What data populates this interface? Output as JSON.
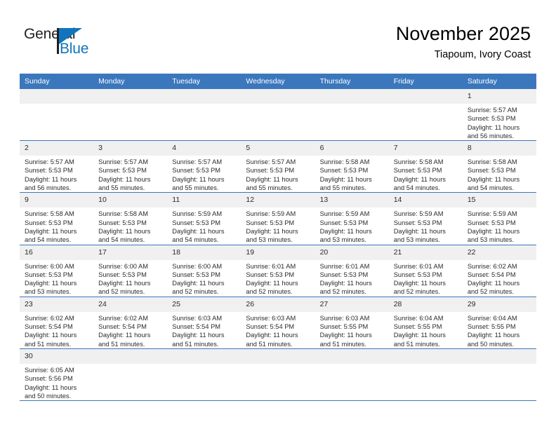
{
  "brand": {
    "name_top": "General",
    "name_bottom": "Blue",
    "triangle_icon": "triangle-icon",
    "accent_color": "#1175be"
  },
  "header": {
    "title": "November 2025",
    "subtitle": "Tiapoum, Ivory Coast"
  },
  "theme": {
    "header_blue": "#3b77bd",
    "daynum_gray": "#f0f0f0"
  },
  "calendar": {
    "weekday_headers": [
      "Sunday",
      "Monday",
      "Tuesday",
      "Wednesday",
      "Thursday",
      "Friday",
      "Saturday"
    ],
    "weeks": [
      [
        {
          "day": "",
          "blank": true
        },
        {
          "day": "",
          "blank": true
        },
        {
          "day": "",
          "blank": true
        },
        {
          "day": "",
          "blank": true
        },
        {
          "day": "",
          "blank": true
        },
        {
          "day": "",
          "blank": true
        },
        {
          "day": "1",
          "sunrise": "Sunrise: 5:57 AM",
          "sunset": "Sunset: 5:53 PM",
          "daylight": "Daylight: 11 hours and 56 minutes."
        }
      ],
      [
        {
          "day": "2",
          "sunrise": "Sunrise: 5:57 AM",
          "sunset": "Sunset: 5:53 PM",
          "daylight": "Daylight: 11 hours and 56 minutes."
        },
        {
          "day": "3",
          "sunrise": "Sunrise: 5:57 AM",
          "sunset": "Sunset: 5:53 PM",
          "daylight": "Daylight: 11 hours and 55 minutes."
        },
        {
          "day": "4",
          "sunrise": "Sunrise: 5:57 AM",
          "sunset": "Sunset: 5:53 PM",
          "daylight": "Daylight: 11 hours and 55 minutes."
        },
        {
          "day": "5",
          "sunrise": "Sunrise: 5:57 AM",
          "sunset": "Sunset: 5:53 PM",
          "daylight": "Daylight: 11 hours and 55 minutes."
        },
        {
          "day": "6",
          "sunrise": "Sunrise: 5:58 AM",
          "sunset": "Sunset: 5:53 PM",
          "daylight": "Daylight: 11 hours and 55 minutes."
        },
        {
          "day": "7",
          "sunrise": "Sunrise: 5:58 AM",
          "sunset": "Sunset: 5:53 PM",
          "daylight": "Daylight: 11 hours and 54 minutes."
        },
        {
          "day": "8",
          "sunrise": "Sunrise: 5:58 AM",
          "sunset": "Sunset: 5:53 PM",
          "daylight": "Daylight: 11 hours and 54 minutes."
        }
      ],
      [
        {
          "day": "9",
          "sunrise": "Sunrise: 5:58 AM",
          "sunset": "Sunset: 5:53 PM",
          "daylight": "Daylight: 11 hours and 54 minutes."
        },
        {
          "day": "10",
          "sunrise": "Sunrise: 5:58 AM",
          "sunset": "Sunset: 5:53 PM",
          "daylight": "Daylight: 11 hours and 54 minutes."
        },
        {
          "day": "11",
          "sunrise": "Sunrise: 5:59 AM",
          "sunset": "Sunset: 5:53 PM",
          "daylight": "Daylight: 11 hours and 54 minutes."
        },
        {
          "day": "12",
          "sunrise": "Sunrise: 5:59 AM",
          "sunset": "Sunset: 5:53 PM",
          "daylight": "Daylight: 11 hours and 53 minutes."
        },
        {
          "day": "13",
          "sunrise": "Sunrise: 5:59 AM",
          "sunset": "Sunset: 5:53 PM",
          "daylight": "Daylight: 11 hours and 53 minutes."
        },
        {
          "day": "14",
          "sunrise": "Sunrise: 5:59 AM",
          "sunset": "Sunset: 5:53 PM",
          "daylight": "Daylight: 11 hours and 53 minutes."
        },
        {
          "day": "15",
          "sunrise": "Sunrise: 5:59 AM",
          "sunset": "Sunset: 5:53 PM",
          "daylight": "Daylight: 11 hours and 53 minutes."
        }
      ],
      [
        {
          "day": "16",
          "sunrise": "Sunrise: 6:00 AM",
          "sunset": "Sunset: 5:53 PM",
          "daylight": "Daylight: 11 hours and 53 minutes."
        },
        {
          "day": "17",
          "sunrise": "Sunrise: 6:00 AM",
          "sunset": "Sunset: 5:53 PM",
          "daylight": "Daylight: 11 hours and 52 minutes."
        },
        {
          "day": "18",
          "sunrise": "Sunrise: 6:00 AM",
          "sunset": "Sunset: 5:53 PM",
          "daylight": "Daylight: 11 hours and 52 minutes."
        },
        {
          "day": "19",
          "sunrise": "Sunrise: 6:01 AM",
          "sunset": "Sunset: 5:53 PM",
          "daylight": "Daylight: 11 hours and 52 minutes."
        },
        {
          "day": "20",
          "sunrise": "Sunrise: 6:01 AM",
          "sunset": "Sunset: 5:53 PM",
          "daylight": "Daylight: 11 hours and 52 minutes."
        },
        {
          "day": "21",
          "sunrise": "Sunrise: 6:01 AM",
          "sunset": "Sunset: 5:53 PM",
          "daylight": "Daylight: 11 hours and 52 minutes."
        },
        {
          "day": "22",
          "sunrise": "Sunrise: 6:02 AM",
          "sunset": "Sunset: 5:54 PM",
          "daylight": "Daylight: 11 hours and 52 minutes."
        }
      ],
      [
        {
          "day": "23",
          "sunrise": "Sunrise: 6:02 AM",
          "sunset": "Sunset: 5:54 PM",
          "daylight": "Daylight: 11 hours and 51 minutes."
        },
        {
          "day": "24",
          "sunrise": "Sunrise: 6:02 AM",
          "sunset": "Sunset: 5:54 PM",
          "daylight": "Daylight: 11 hours and 51 minutes."
        },
        {
          "day": "25",
          "sunrise": "Sunrise: 6:03 AM",
          "sunset": "Sunset: 5:54 PM",
          "daylight": "Daylight: 11 hours and 51 minutes."
        },
        {
          "day": "26",
          "sunrise": "Sunrise: 6:03 AM",
          "sunset": "Sunset: 5:54 PM",
          "daylight": "Daylight: 11 hours and 51 minutes."
        },
        {
          "day": "27",
          "sunrise": "Sunrise: 6:03 AM",
          "sunset": "Sunset: 5:55 PM",
          "daylight": "Daylight: 11 hours and 51 minutes."
        },
        {
          "day": "28",
          "sunrise": "Sunrise: 6:04 AM",
          "sunset": "Sunset: 5:55 PM",
          "daylight": "Daylight: 11 hours and 51 minutes."
        },
        {
          "day": "29",
          "sunrise": "Sunrise: 6:04 AM",
          "sunset": "Sunset: 5:55 PM",
          "daylight": "Daylight: 11 hours and 50 minutes."
        }
      ],
      [
        {
          "day": "30",
          "sunrise": "Sunrise: 6:05 AM",
          "sunset": "Sunset: 5:56 PM",
          "daylight": "Daylight: 11 hours and 50 minutes."
        },
        {
          "day": "",
          "blank": true
        },
        {
          "day": "",
          "blank": true
        },
        {
          "day": "",
          "blank": true
        },
        {
          "day": "",
          "blank": true
        },
        {
          "day": "",
          "blank": true
        },
        {
          "day": "",
          "blank": true
        }
      ]
    ]
  }
}
